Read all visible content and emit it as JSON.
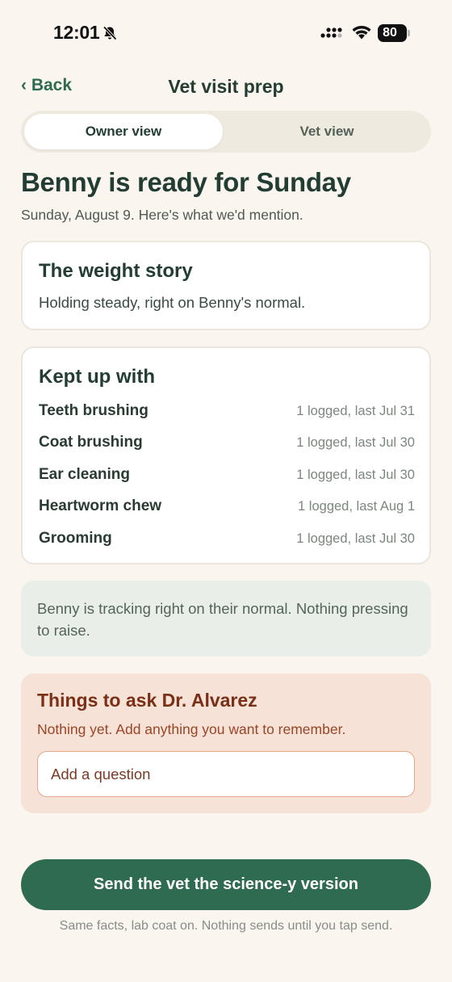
{
  "status_bar": {
    "time": "12:01",
    "battery": "80"
  },
  "nav": {
    "back_label": "‹ Back",
    "title": "Vet visit prep"
  },
  "segmented": {
    "owner_label": "Owner view",
    "vet_label": "Vet view",
    "selected": "Owner view"
  },
  "headline": "Benny is ready for Sunday",
  "subline": "Sunday, August 9. Here's what we'd mention.",
  "weight_card": {
    "title": "The weight story",
    "body": "Holding steady, right on Benny's normal."
  },
  "kept_card": {
    "title": "Kept up with",
    "items": [
      {
        "name": "Teeth brushing",
        "meta": "1 logged, last Jul 31"
      },
      {
        "name": "Coat brushing",
        "meta": "1 logged, last Jul 30"
      },
      {
        "name": "Ear cleaning",
        "meta": "1 logged, last Jul 30"
      },
      {
        "name": "Heartworm chew",
        "meta": "1 logged, last Aug 1"
      },
      {
        "name": "Grooming",
        "meta": "1 logged, last Jul 30"
      }
    ]
  },
  "note": "Benny is tracking right on their normal. Nothing pressing to raise.",
  "ask": {
    "title": "Things to ask Dr. Alvarez",
    "subtitle": "Nothing yet. Add anything you want to remember.",
    "placeholder": "Add a question",
    "value": ""
  },
  "cta_label": "Send the vet the science-y version",
  "footnote": "Same facts, lab coat on. Nothing sends until you tap send.",
  "colors": {
    "background": "#faf5ef",
    "accent": "#2e6b50",
    "ask_background": "#f6e2d6",
    "ask_text": "#7a2f17",
    "note_background": "#eaeee8"
  }
}
